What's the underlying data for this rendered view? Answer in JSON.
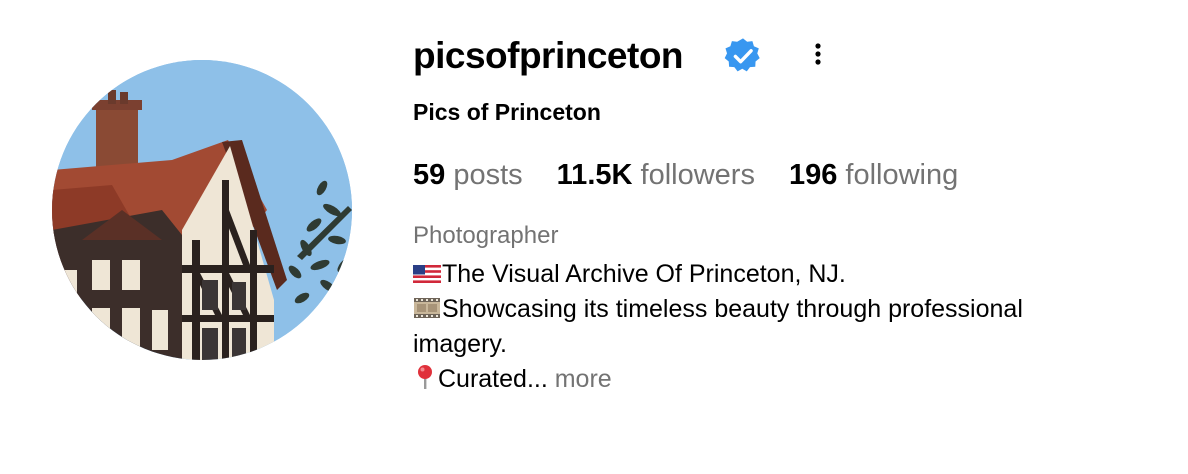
{
  "profile": {
    "username": "picsofprinceton",
    "verified": true,
    "full_name": "Pics of Princeton",
    "category": "Photographer",
    "icons": {
      "verified": "verified-badge-icon",
      "more": "more-options-icon",
      "avatar": "profile-photo-tudor-house"
    },
    "colors": {
      "verified_badge": "#3897f0",
      "secondary_text": "#737373"
    }
  },
  "stats": {
    "posts_count": "59",
    "posts_label": "posts",
    "followers_count": "11.5K",
    "followers_label": "followers",
    "following_count": "196",
    "following_label": "following"
  },
  "bio": {
    "line1_icon": "us-flag-emoji",
    "line1": "The Visual Archive Of Princeton, NJ.",
    "line2_icon": "film-frames-emoji",
    "line2": "Showcasing its timeless beauty through professional",
    "line3": "imagery.",
    "line4_icon": "round-pushpin-emoji",
    "line4": "Curated... ",
    "more": "more"
  }
}
